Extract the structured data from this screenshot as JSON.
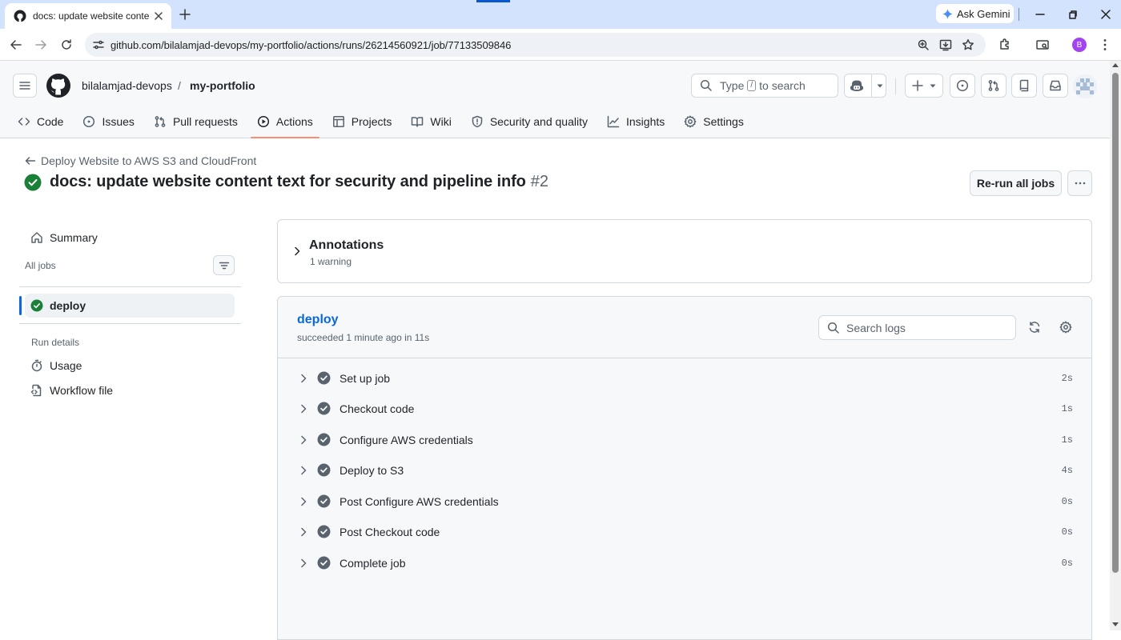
{
  "browser": {
    "tab_title": "docs: update website content text for security and pipeline info · bilalamjad-devops/my-portfolio",
    "url": "github.com/bilalamjad-devops/my-portfolio/actions/runs/26214560921/job/77133509846",
    "ask_gemini": "Ask Gemini",
    "profile_initial": "B"
  },
  "header": {
    "owner": "bilalamjad-devops",
    "separator": "/",
    "repo": "my-portfolio",
    "search_prefix": "Type",
    "search_key": "/",
    "search_suffix": "to search"
  },
  "repo_nav": [
    {
      "label": "Code",
      "icon": "code-icon"
    },
    {
      "label": "Issues",
      "icon": "issue-icon"
    },
    {
      "label": "Pull requests",
      "icon": "pull-request-icon"
    },
    {
      "label": "Actions",
      "icon": "play-icon",
      "active": true
    },
    {
      "label": "Projects",
      "icon": "table-icon"
    },
    {
      "label": "Wiki",
      "icon": "book-icon"
    },
    {
      "label": "Security and quality",
      "icon": "shield-icon"
    },
    {
      "label": "Insights",
      "icon": "graph-icon"
    },
    {
      "label": "Settings",
      "icon": "gear-icon"
    }
  ],
  "run": {
    "back_label": "Deploy Website to AWS S3 and CloudFront",
    "title": "docs: update website content text for security and pipeline info",
    "number": "#2",
    "rerun_label": "Re-run all jobs",
    "status_color": "#1a7f37"
  },
  "sidebar": {
    "summary": "Summary",
    "all_jobs": "All jobs",
    "job": "deploy",
    "run_details": "Run details",
    "usage": "Usage",
    "workflow_file": "Workflow file"
  },
  "annotations": {
    "title": "Annotations",
    "subtitle": "1 warning"
  },
  "job": {
    "name": "deploy",
    "status": "succeeded 1 minute ago in 11s",
    "search_placeholder": "Search logs",
    "steps": [
      {
        "name": "Set up job",
        "duration": "2s"
      },
      {
        "name": "Checkout code",
        "duration": "1s"
      },
      {
        "name": "Configure AWS credentials",
        "duration": "1s"
      },
      {
        "name": "Deploy to S3",
        "duration": "4s"
      },
      {
        "name": "Post Configure AWS credentials",
        "duration": "0s"
      },
      {
        "name": "Post Checkout code",
        "duration": "0s"
      },
      {
        "name": "Complete job",
        "duration": "0s"
      }
    ]
  }
}
